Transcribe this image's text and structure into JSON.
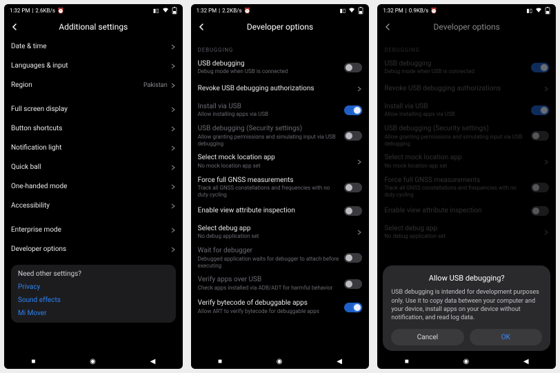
{
  "status": {
    "s1": {
      "time": "1:32 PM",
      "net": "2.6KB/s"
    },
    "s2": {
      "time": "1:32 PM",
      "net": "2.2KB/s"
    },
    "s3": {
      "time": "1:32 PM",
      "net": "0.9KB/s"
    }
  },
  "screen1": {
    "title": "Additional settings",
    "rows": {
      "date_time": "Date & time",
      "lang": "Languages & input",
      "region": "Region",
      "region_val": "Pakistan",
      "fullscreen": "Full screen display",
      "button_shortcuts": "Button shortcuts",
      "notif_light": "Notification light",
      "quick_ball": "Quick ball",
      "one_handed": "One-handed mode",
      "accessibility": "Accessibility",
      "enterprise": "Enterprise mode",
      "developer": "Developer options"
    },
    "suggest": {
      "q": "Need other settings?",
      "privacy": "Privacy",
      "sound": "Sound effects",
      "mover": "Mi Mover"
    }
  },
  "dev": {
    "title": "Developer options",
    "section_debugging": "DEBUGGING",
    "usb_debug": "USB debugging",
    "usb_debug_sub": "Debug mode when USB is connected",
    "revoke": "Revoke USB debugging authorizations",
    "install_usb": "Install via USB",
    "install_usb_sub": "Allow installing apps via USB",
    "usb_sec": "USB debugging (Security settings)",
    "usb_sec_sub": "Allow granting permissions and simulating input via USB debugging",
    "mock_loc": "Select mock location app",
    "mock_loc_sub": "No mock location app set",
    "gnss": "Force full GNSS measurements",
    "gnss_sub": "Track all GNSS constellations and frequencies with no duty cycling",
    "view_attr": "Enable view attribute inspection",
    "debug_app": "Select debug app",
    "debug_app_sub": "No debug application set",
    "wait_debugger": "Wait for debugger",
    "wait_debugger_sub": "Debugged application waits for debugger to attach before executing",
    "verify_usb": "Verify apps over USB",
    "verify_usb_sub": "Check apps installed via ADB/ADT for harmful behavior",
    "verify_bytecode": "Verify bytecode of debuggable apps",
    "verify_bytecode_sub": "Allow ART to verify bytecode for debuggable apps"
  },
  "dialog": {
    "title": "Allow USB debugging?",
    "body": "USB debugging is intended for development purposes only. Use it to copy data between your computer and your device, install apps on your device without notification, and read log data.",
    "cancel": "Cancel",
    "ok": "OK"
  }
}
